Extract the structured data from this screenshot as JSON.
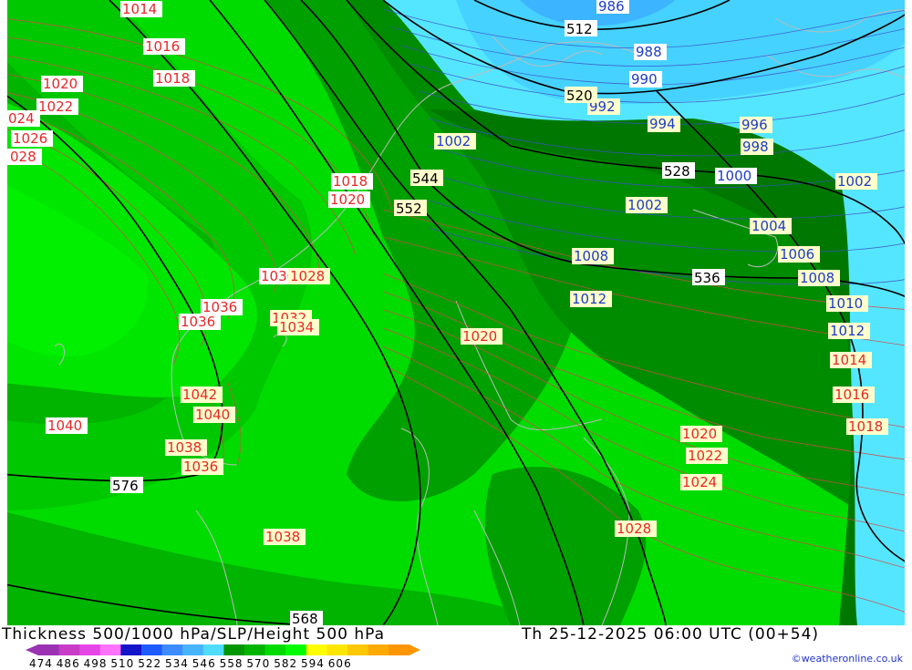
{
  "footer": {
    "title": "Thickness 500/1000 hPa/SLP/Height 500 hPa",
    "datetime": "Th 25-12-2025 06:00 UTC (00+54)",
    "credit": "©weatheronline.co.uk"
  },
  "scale": {
    "ticks": [
      "474",
      "486",
      "498",
      "510",
      "522",
      "534",
      "546",
      "558",
      "570",
      "582",
      "594",
      "606"
    ],
    "colors": [
      "#9b32b4",
      "#c83cc8",
      "#e646e6",
      "#ff73ff",
      "#1414c8",
      "#1e5aff",
      "#3c8cff",
      "#46b4ff",
      "#50dcff",
      "#009600",
      "#00b400",
      "#00dc00",
      "#00ff00",
      "#ffff00",
      "#ffe600",
      "#ffc800",
      "#ffaa00",
      "#ff9600"
    ]
  },
  "isobar_labels": [
    "1014",
    "1016",
    "1018",
    "1020",
    "1022",
    "024",
    "1026",
    "028",
    "1018",
    "1020",
    "1030",
    "1028",
    "1036",
    "1032",
    "1036",
    "1034",
    "1042",
    "1040",
    "1040",
    "1038",
    "1036",
    "1038",
    "1020",
    "1020",
    "1022",
    "1024",
    "1028",
    "1018",
    "1016",
    "1014",
    "1012",
    "1010",
    "1008",
    "1006",
    "1004",
    "1002",
    "1000",
    "998",
    "996",
    "994",
    "992",
    "990",
    "988",
    "986",
    "1002",
    "1002",
    "1008",
    "1012"
  ],
  "height_labels": [
    "512",
    "520",
    "528",
    "536",
    "544",
    "552",
    "576",
    "568"
  ]
}
